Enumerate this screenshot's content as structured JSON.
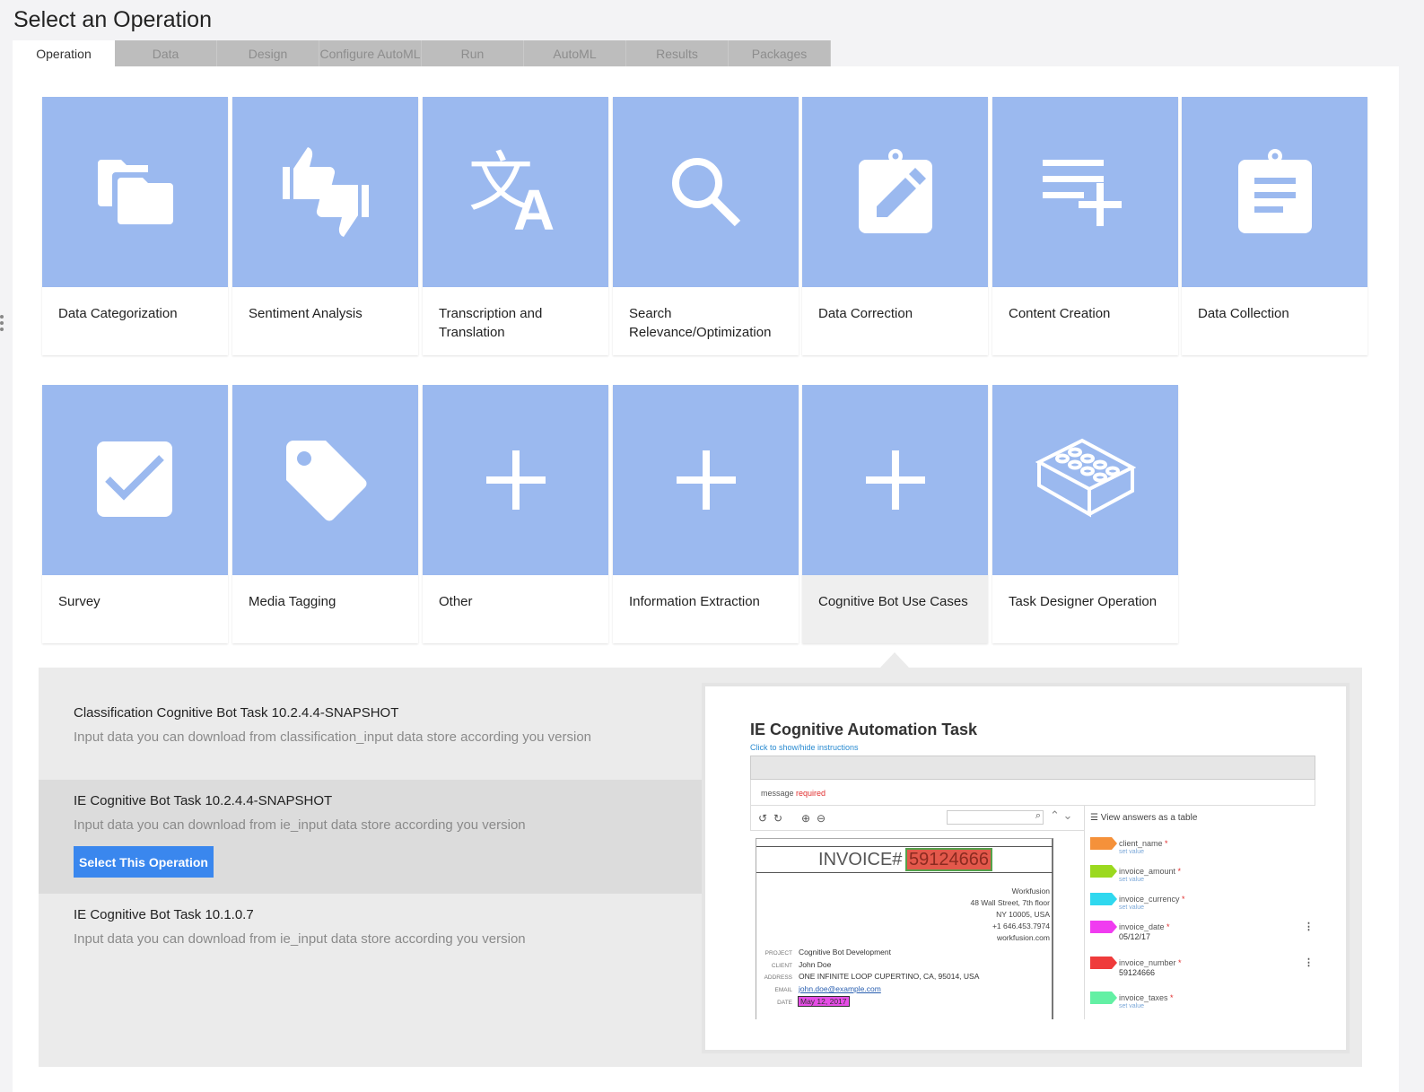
{
  "page": {
    "title": "Select an Operation"
  },
  "tabs": [
    {
      "label": "Operation",
      "active": true
    },
    {
      "label": "Data"
    },
    {
      "label": "Design"
    },
    {
      "label": "Configure AutoML"
    },
    {
      "label": "Run"
    },
    {
      "label": "AutoML"
    },
    {
      "label": "Results"
    },
    {
      "label": "Packages"
    }
  ],
  "operations": [
    {
      "label": "Data Categorization",
      "icon": "folders-icon"
    },
    {
      "label": "Sentiment Analysis",
      "icon": "thumbs-icon"
    },
    {
      "label": "Transcription and Translation",
      "icon": "translate-icon"
    },
    {
      "label": "Search Relevance/Optimization",
      "icon": "search-icon"
    },
    {
      "label": "Data Correction",
      "icon": "clipboard-edit-icon"
    },
    {
      "label": "Content Creation",
      "icon": "playlist-add-icon"
    },
    {
      "label": "Data Collection",
      "icon": "clipboard-list-icon"
    },
    {
      "label": "Survey",
      "icon": "checkbox-icon"
    },
    {
      "label": "Media Tagging",
      "icon": "tag-icon"
    },
    {
      "label": "Other",
      "icon": "plus-icon"
    },
    {
      "label": "Information Extraction",
      "icon": "plus-icon"
    },
    {
      "label": "Cognitive Bot Use Cases",
      "icon": "plus-icon",
      "selected": true
    },
    {
      "label": "Task Designer Operation",
      "icon": "lego-brick-icon"
    }
  ],
  "sub_operations": [
    {
      "title": "Classification Cognitive Bot Task 10.2.4.4-SNAPSHOT",
      "description": "Input data you can download from classification_input data store according you version"
    },
    {
      "title": "IE Cognitive Bot Task 10.2.4.4-SNAPSHOT",
      "description": "Input data you can download from ie_input data store according you version",
      "active": true
    },
    {
      "title": "IE Cognitive Bot Task 10.1.0.7",
      "description": "Input data you can download from ie_input data store according you version"
    }
  ],
  "select_button": {
    "label": "Select This Operation"
  },
  "preview": {
    "title": "IE Cognitive Automation Task",
    "instructions_link": "Click to show/hide instructions",
    "message_label": "message",
    "message_required": "required",
    "side_header": "View answers as a table",
    "invoice": {
      "heading": "INVOICE#",
      "number": "59124666",
      "address_lines": [
        "Workfusion",
        "48 Wall Street, 7th floor",
        "NY 10005, USA",
        "+1 646.453.7974",
        "workfusion.com"
      ],
      "rows": [
        {
          "key": "PROJECT",
          "value": "Cognitive Bot Development"
        },
        {
          "key": "CLIENT",
          "value": "John Doe"
        },
        {
          "key": "ADDRESS",
          "value": "ONE INFINITE LOOP CUPERTINO, CA, 95014, USA"
        },
        {
          "key": "EMAIL",
          "value": "john.doe@example.com"
        },
        {
          "key": "DATE",
          "value": "May 12, 2017"
        }
      ]
    },
    "fields": [
      {
        "name": "client_name",
        "sub": "set value",
        "color": "#f5913a"
      },
      {
        "name": "invoice_amount",
        "sub": "set value",
        "color": "#9bd91f"
      },
      {
        "name": "invoice_currency",
        "sub": "set value",
        "color": "#2fd8ef"
      },
      {
        "name": "invoice_date",
        "value": "05/12/17",
        "color": "#f03cf0"
      },
      {
        "name": "invoice_number",
        "value": "59124666",
        "color": "#ef3b3b"
      },
      {
        "name": "invoice_taxes",
        "sub": "set value",
        "color": "#63f0a4"
      }
    ]
  },
  "colors": {
    "tile": "#9bb9ef",
    "button": "#3a87ee",
    "required": "#e12d2d"
  }
}
